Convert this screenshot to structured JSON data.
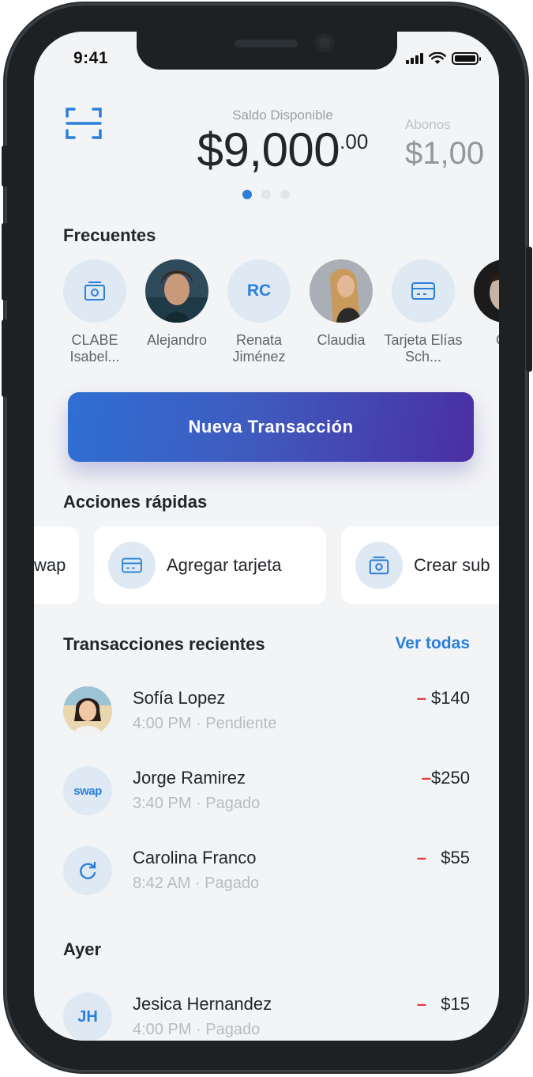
{
  "status": {
    "time": "9:41"
  },
  "balance": {
    "label": "Saldo Disponible",
    "amount": "$9,000",
    "cents": ".00"
  },
  "abonos": {
    "label": "Abonos",
    "amount": "$1,00"
  },
  "frequents": {
    "title": "Frecuentes",
    "items": [
      {
        "label": "CLABE Isabel...",
        "type": "icon",
        "icon": "bank-icon"
      },
      {
        "label": "Alejandro",
        "type": "photo"
      },
      {
        "label": "Renata Jiménez",
        "type": "initials",
        "initials": "RC"
      },
      {
        "label": "Claudia",
        "type": "photo"
      },
      {
        "label": "Tarjeta Elías Sch...",
        "type": "icon",
        "icon": "card-icon"
      },
      {
        "label": "Go",
        "type": "photo"
      }
    ]
  },
  "cta": {
    "label": "Nueva Transacción"
  },
  "quick_actions": {
    "title": "Acciones rápidas",
    "items": [
      {
        "label": "wap"
      },
      {
        "label": "Agregar tarjeta",
        "icon": "card-icon"
      },
      {
        "label": "Crear sub",
        "icon": "bank-icon"
      }
    ]
  },
  "recent": {
    "title": "Transacciones recientes",
    "see_all": "Ver todas",
    "items": [
      {
        "name": "Sofía Lopez",
        "meta": "4:00 PM · Pendiente",
        "sign": "–",
        "amount": "$140"
      },
      {
        "name": "Jorge Ramirez",
        "meta": "3:40 PM · Pagado",
        "sign": "–",
        "amount": "$250",
        "logo": "swap"
      },
      {
        "name": "Carolina Franco",
        "meta": "8:42 AM · Pagado",
        "sign": "–",
        "amount": "$55"
      }
    ]
  },
  "yesterday": {
    "title": "Ayer",
    "items": [
      {
        "name": "Jesica Hernandez",
        "meta": "4:00 PM · Pagado",
        "sign": "–",
        "amount": "$15",
        "initials": "JH"
      }
    ]
  },
  "colors": {
    "accent": "#2b7fd9",
    "negative": "#e53a3a",
    "cta_start": "#2f6fd3",
    "cta_end": "#4a2fa3"
  }
}
